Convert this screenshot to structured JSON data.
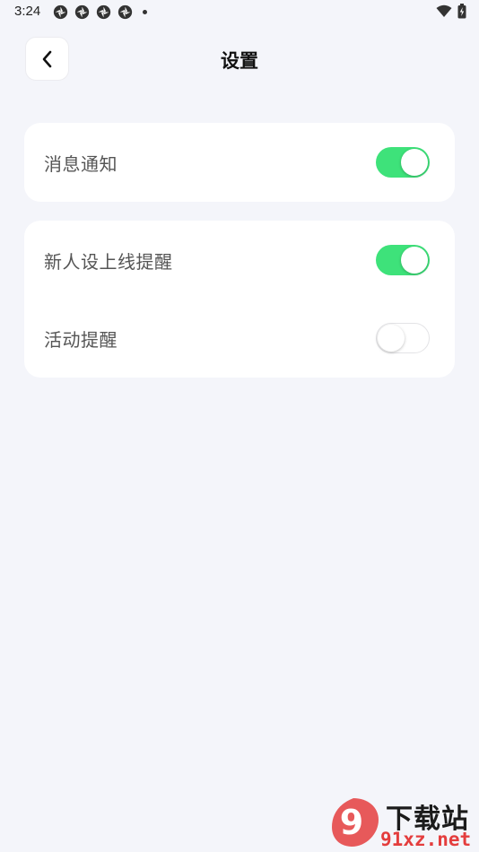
{
  "status_bar": {
    "time": "3:24"
  },
  "header": {
    "title": "设置",
    "back_icon": "chevron-left-icon"
  },
  "settings": {
    "group1": [
      {
        "label": "消息通知",
        "enabled": true
      }
    ],
    "group2": [
      {
        "label": "新人设上线提醒",
        "enabled": true
      },
      {
        "label": "活动提醒",
        "enabled": false
      }
    ]
  },
  "colors": {
    "background": "#f4f5fa",
    "toggle_on": "#3ee27a",
    "card": "#ffffff"
  },
  "watermark": {
    "title": "下载站",
    "url": "91xz.net",
    "badge_text": "9"
  }
}
